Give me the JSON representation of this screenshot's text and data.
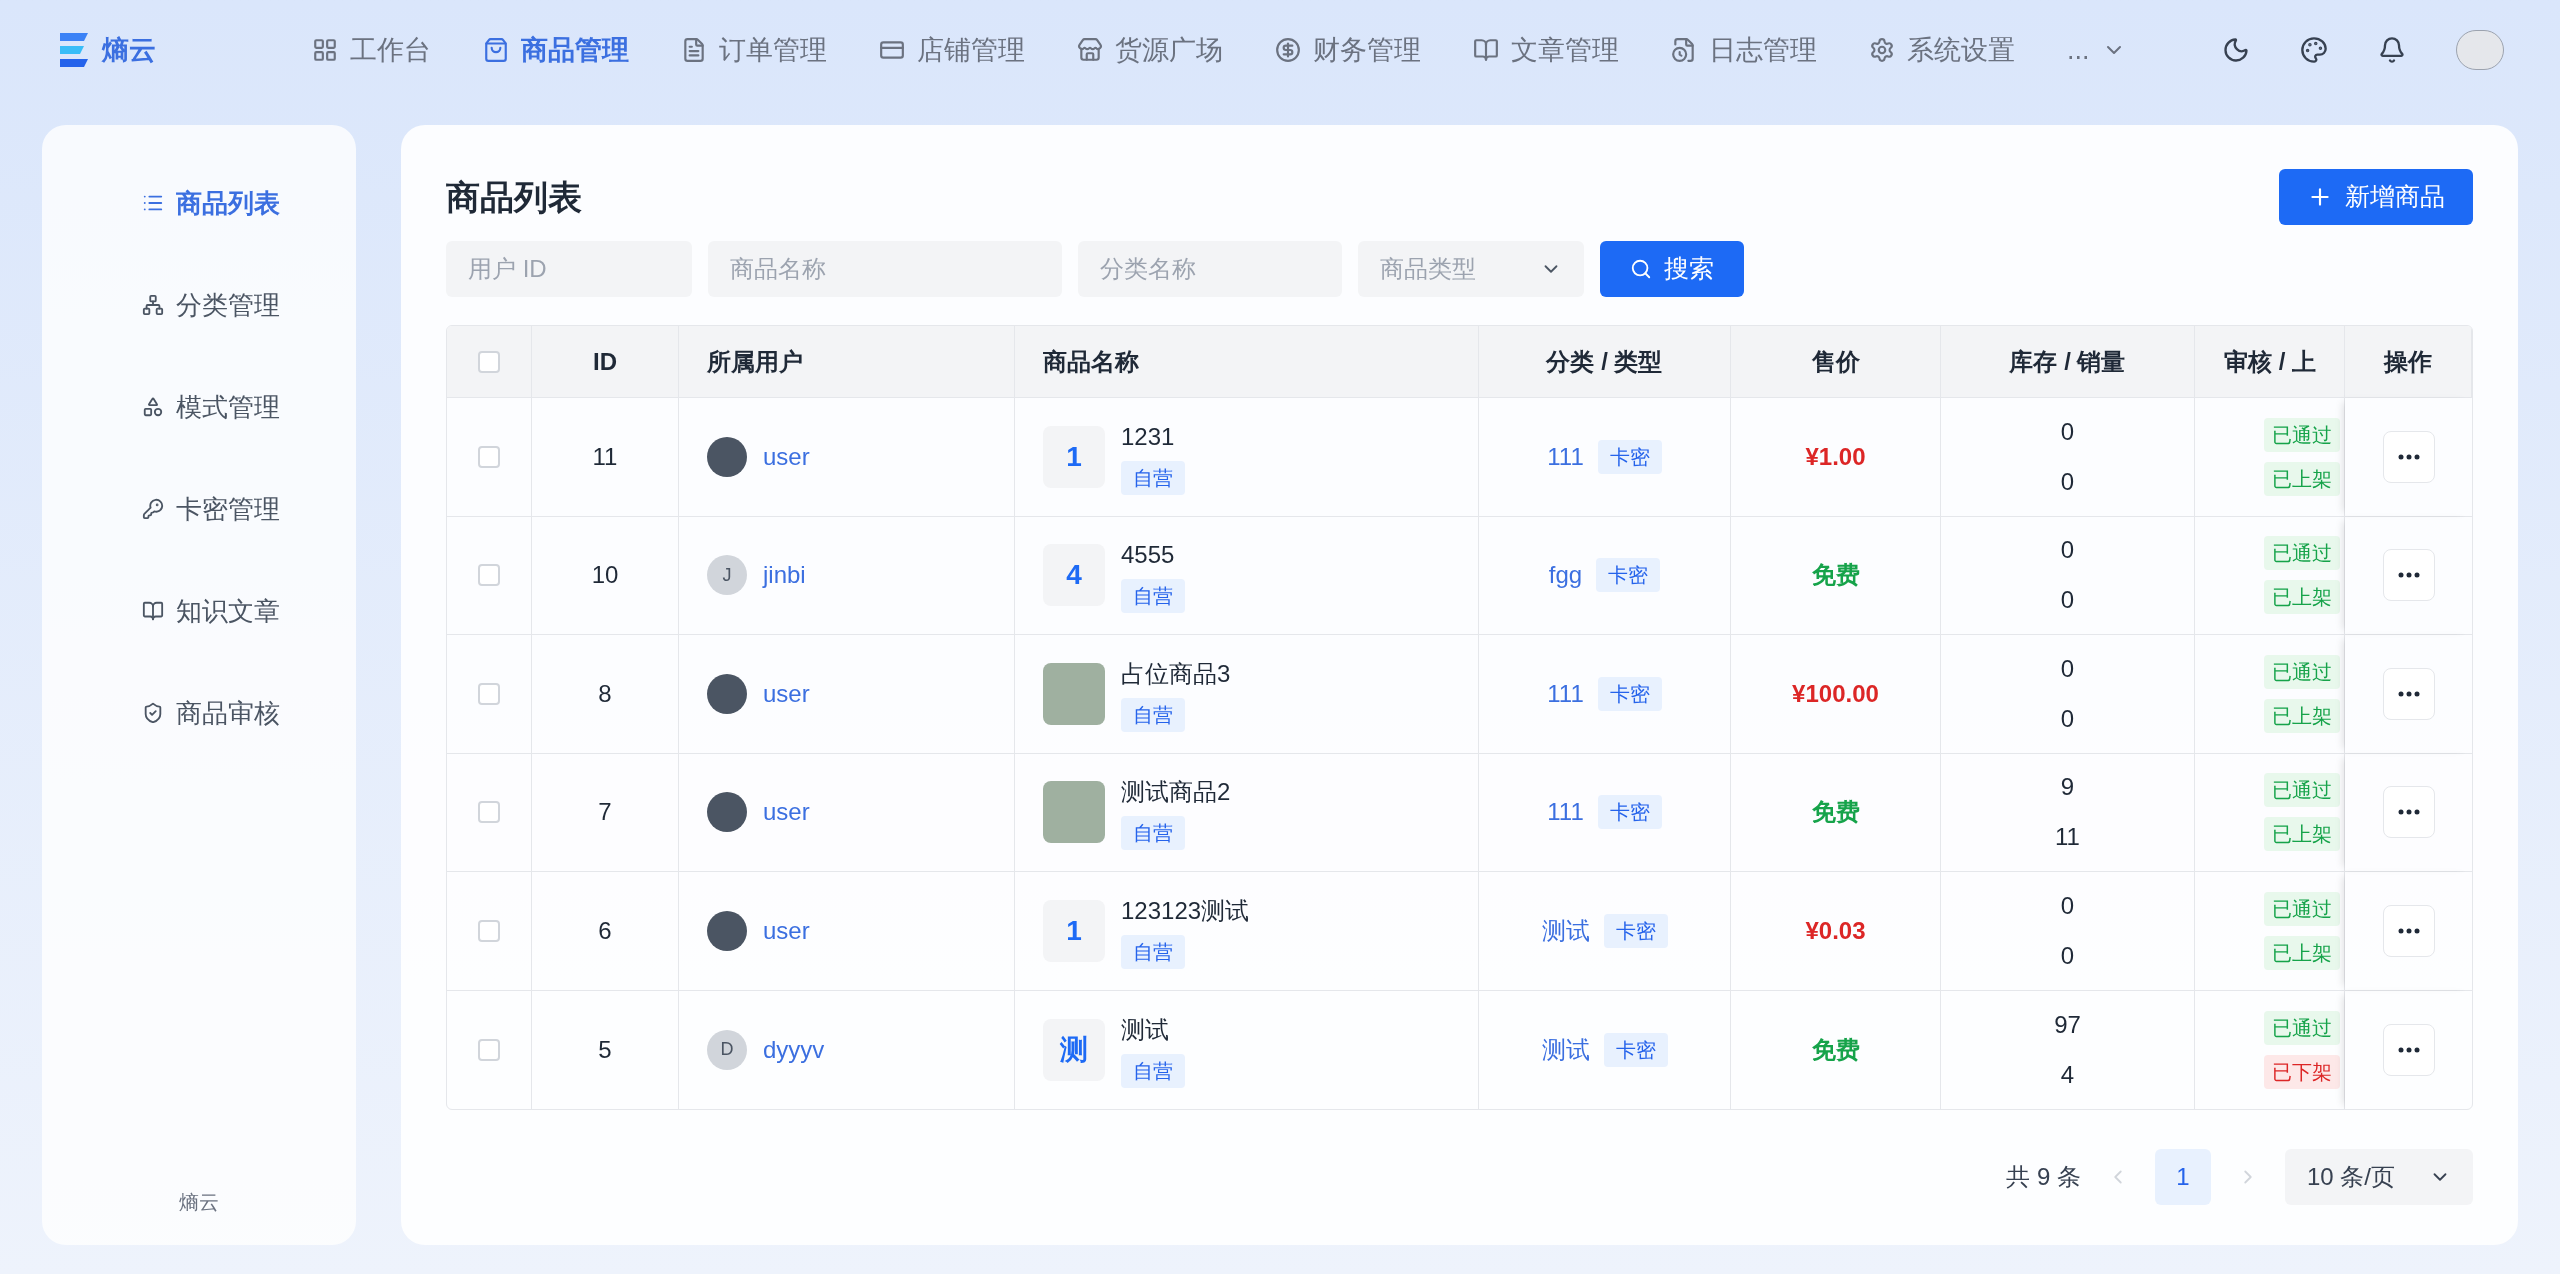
{
  "brand": {
    "name": "熵云"
  },
  "nav": [
    {
      "label": "工作台",
      "selected": false
    },
    {
      "label": "商品管理",
      "selected": true
    },
    {
      "label": "订单管理",
      "selected": false
    },
    {
      "label": "店铺管理",
      "selected": false
    },
    {
      "label": "货源广场",
      "selected": false
    },
    {
      "label": "财务管理",
      "selected": false
    },
    {
      "label": "文章管理",
      "selected": false
    },
    {
      "label": "日志管理",
      "selected": false
    },
    {
      "label": "系统设置",
      "selected": false
    }
  ],
  "nav_more": "...",
  "sidebar": {
    "items": [
      {
        "label": "商品列表",
        "selected": true
      },
      {
        "label": "分类管理",
        "selected": false
      },
      {
        "label": "模式管理",
        "selected": false
      },
      {
        "label": "卡密管理",
        "selected": false
      },
      {
        "label": "知识文章",
        "selected": false
      },
      {
        "label": "商品审核",
        "selected": false
      }
    ],
    "footer": "熵云"
  },
  "page_title": "商品列表",
  "add_button": "新增商品",
  "filters": [
    {
      "placeholder": "用户 ID",
      "kind": "input"
    },
    {
      "placeholder": "商品名称",
      "kind": "input"
    },
    {
      "placeholder": "分类名称",
      "kind": "input"
    },
    {
      "placeholder": "商品类型",
      "kind": "select"
    }
  ],
  "search_button": "搜索",
  "table": {
    "all_checked": false,
    "columns": [
      "ID",
      "所属用户",
      "商品名称",
      "分类 / 类型",
      "售价",
      "库存 / 销量",
      "审核 / 上",
      "操作"
    ],
    "rows": [
      {
        "checked": false,
        "id": "11",
        "user": "user",
        "avatar": {
          "kind": "image"
        },
        "thumb": {
          "kind": "text",
          "text": "1"
        },
        "name": "1231",
        "tag": "自营",
        "category": "111",
        "type": "卡密",
        "price": {
          "text": "¥1.00",
          "color": "#dc2626"
        },
        "stock": "0",
        "sales": "0",
        "review": "已通过",
        "listing": "已上架",
        "listed": true
      },
      {
        "checked": false,
        "id": "10",
        "user": "jinbi",
        "avatar": {
          "kind": "letter",
          "text": "J"
        },
        "thumb": {
          "kind": "text",
          "text": "4"
        },
        "name": "4555",
        "tag": "自营",
        "category": "fgg",
        "type": "卡密",
        "price": {
          "text": "免费",
          "color": "#16a34a"
        },
        "stock": "0",
        "sales": "0",
        "review": "已通过",
        "listing": "已上架",
        "listed": true
      },
      {
        "checked": false,
        "id": "8",
        "user": "user",
        "avatar": {
          "kind": "image"
        },
        "thumb": {
          "kind": "image"
        },
        "name": "占位商品3",
        "tag": "自营",
        "category": "111",
        "type": "卡密",
        "price": {
          "text": "¥100.00",
          "color": "#dc2626"
        },
        "stock": "0",
        "sales": "0",
        "review": "已通过",
        "listing": "已上架",
        "listed": true
      },
      {
        "checked": false,
        "id": "7",
        "user": "user",
        "avatar": {
          "kind": "image"
        },
        "thumb": {
          "kind": "image"
        },
        "name": "测试商品2",
        "tag": "自营",
        "category": "111",
        "type": "卡密",
        "price": {
          "text": "免费",
          "color": "#16a34a"
        },
        "stock": "9",
        "sales": "11",
        "review": "已通过",
        "listing": "已上架",
        "listed": true
      },
      {
        "checked": false,
        "id": "6",
        "user": "user",
        "avatar": {
          "kind": "image"
        },
        "thumb": {
          "kind": "text",
          "text": "1"
        },
        "name": "123123测试",
        "tag": "自营",
        "category": "测试",
        "type": "卡密",
        "price": {
          "text": "¥0.03",
          "color": "#dc2626"
        },
        "stock": "0",
        "sales": "0",
        "review": "已通过",
        "listing": "已上架",
        "listed": true
      },
      {
        "checked": false,
        "id": "5",
        "user": "dyyyv",
        "avatar": {
          "kind": "letter",
          "text": "D"
        },
        "thumb": {
          "kind": "text",
          "text": "测"
        },
        "name": "测试",
        "tag": "自营",
        "category": "测试",
        "type": "卡密",
        "price": {
          "text": "免费",
          "color": "#16a34a"
        },
        "stock": "97",
        "sales": "4",
        "review": "已通过",
        "listing": "已下架",
        "listed": false
      }
    ]
  },
  "pagination": {
    "total": "共 9 条",
    "pages": [
      {
        "label": "1",
        "selected": true
      }
    ],
    "page_size": "10 条/页"
  }
}
